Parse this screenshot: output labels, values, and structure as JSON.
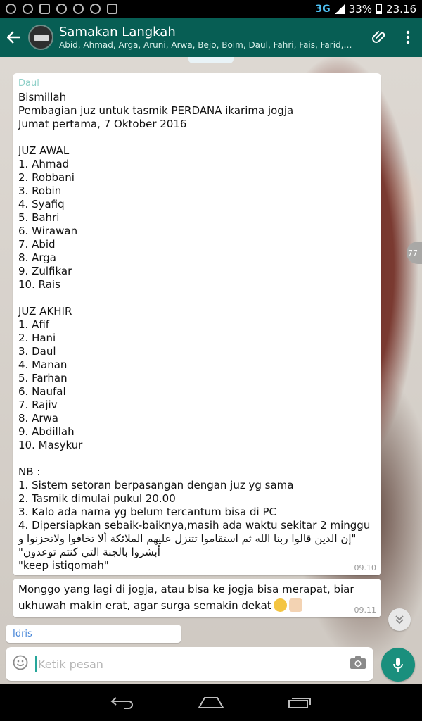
{
  "status_bar": {
    "network": "3G",
    "battery": "33%",
    "time": "23.16"
  },
  "header": {
    "title": "Samakan Langkah",
    "members": "Abid, Ahmad, Arga, Aruni, Arwa, Bejo, Boim, Daul, Fahri, Fais, Farid, Fata..."
  },
  "messages": [
    {
      "sender": "Daul",
      "text": "Bismillah\nPembagian juz untuk tasmik PERDANA ikarima jogja\nJumat pertama, 7 Oktober 2016\n\nJUZ AWAL\n1. Ahmad\n2. Robbani\n3. Robin\n4. Syafiq\n5. Bahri\n6. Wirawan\n7. Abid\n8. Arga\n9. Zulfikar\n10. Rais\n\nJUZ AKHIR\n1. Afif\n2. Hani\n3. Daul\n4. Manan\n5. Farhan\n6. Naufal\n7. Rajiv\n8. Arwa\n9. Abdillah\n10. Masykur\n\nNB :\n1. Sistem setoran berpasangan dengan juz yg sama\n2. Tasmik dimulai pukul 20.00\n3. Kalo ada nama yg belum tercantum bisa di PC\n4. Dipersiapkan sebaik-baiknya,masih ada waktu sekitar 2 minggu",
      "arabic": "\"إن الدين قالوا ربنا الله ثم استقاموا تتنزل عليهم الملائكة ألا تخافوا ولاتحزنوا و أبشروا بالجنة التي كنتم توعدون\"",
      "closing": "\"keep istiqomah\"",
      "time": "09.10"
    },
    {
      "text": "Monggo yang lagi di jogja, atau bisa ke jogja bisa merapat, biar ukhuwah makin erat, agar surga semakin dekat",
      "time": "09.11"
    },
    {
      "sender": "Idris"
    }
  ],
  "scroll_badge": "77",
  "input": {
    "placeholder": "Ketik pesan"
  },
  "colors": {
    "header": "#075e54",
    "accent": "#1a8f7d"
  }
}
